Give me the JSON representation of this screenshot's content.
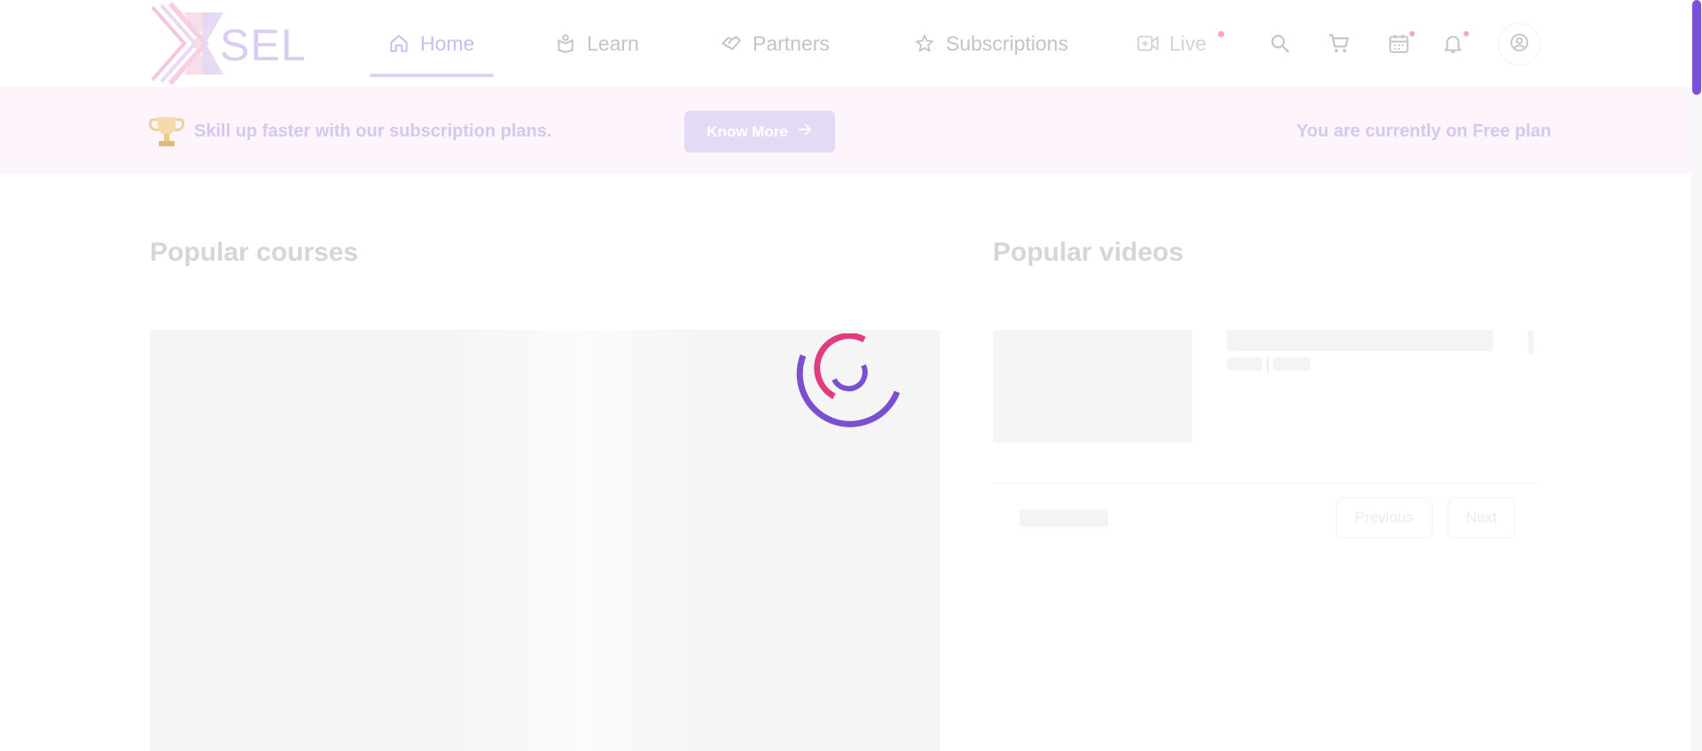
{
  "header": {
    "logo_text": "SEL",
    "nav": [
      {
        "label": "Home",
        "icon": "home-icon",
        "active": true
      },
      {
        "label": "Learn",
        "icon": "learn-icon"
      },
      {
        "label": "Partners",
        "icon": "handshake-icon"
      },
      {
        "label": "Subscriptions",
        "icon": "star-icon"
      },
      {
        "label": "Live",
        "icon": "video-add-icon"
      }
    ],
    "icons": [
      "search-icon",
      "cart-icon",
      "calendar-icon",
      "bell-icon",
      "user-icon"
    ]
  },
  "banner": {
    "message": "Skill up faster with our subscription plans.",
    "button_label": "Know More",
    "plan_status": "You are currently on Free plan"
  },
  "sections": {
    "courses_title": "Popular courses",
    "videos_title": "Popular videos"
  },
  "pagination": {
    "previous_label": "Previous",
    "next_label": "Next"
  },
  "colors": {
    "accent": "#7b4fd8",
    "accent_pink": "#e33b7f",
    "banner_bg": "#fdf5fb"
  }
}
